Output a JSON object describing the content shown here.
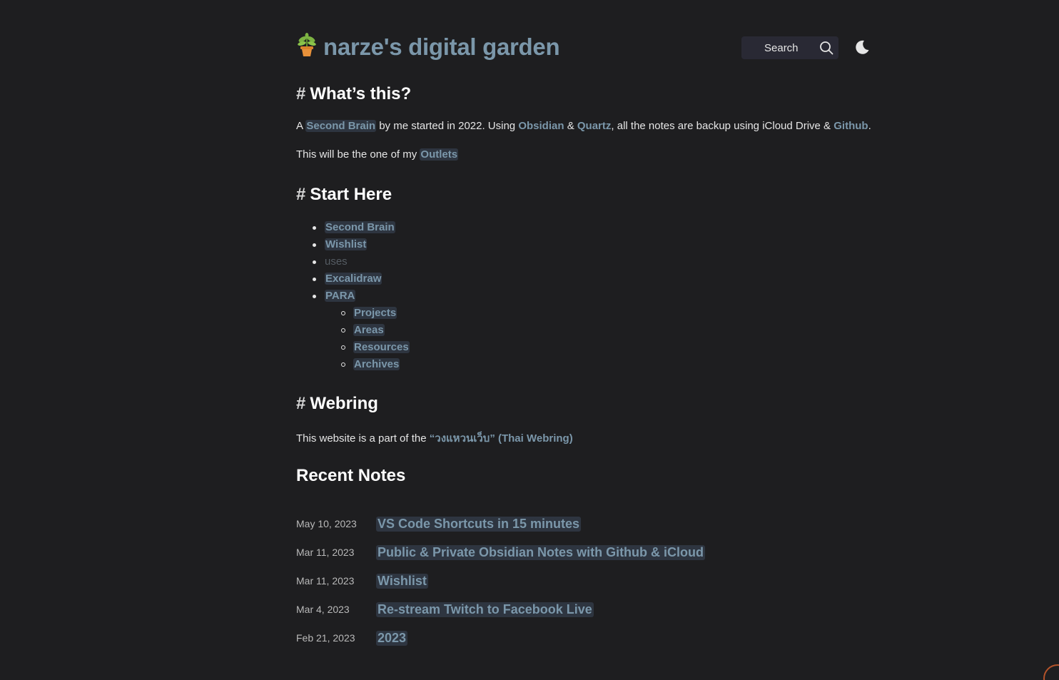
{
  "header": {
    "logo_emoji": "🪴",
    "title": "narze's digital garden",
    "search_label": "Search"
  },
  "sections": {
    "whats_this": {
      "hash": "#",
      "title": "What’s this?",
      "p1": {
        "a": "A",
        "link_second_brain": "Second Brain",
        "t1": "by me started in 2022. Using",
        "link_obsidian": "Obsidian",
        "amp1": "&",
        "link_quartz": "Quartz",
        "t2": ", all the notes are backup using iCloud Drive &",
        "link_github": "Github",
        "t3": "."
      },
      "p2": {
        "text": "This will be the one of my",
        "link_outlets": "Outlets"
      }
    },
    "start_here": {
      "hash": "#",
      "title": "Start Here",
      "items": [
        "Second Brain",
        "Wishlist",
        "uses",
        "Excalidraw",
        "PARA"
      ],
      "para_items": [
        "Projects",
        "Areas",
        "Resources",
        "Archives"
      ]
    },
    "webring": {
      "hash": "#",
      "title": "Webring",
      "text": "This website is a part of the",
      "link": "“วงแหวนเว็บ” (Thai Webring)"
    }
  },
  "recent_notes": {
    "title": "Recent Notes",
    "items": [
      {
        "date": "May 10, 2023",
        "title": "VS Code Shortcuts in 15 minutes"
      },
      {
        "date": "Mar 11, 2023",
        "title": "Public & Private Obsidian Notes with Github & iCloud"
      },
      {
        "date": "Mar 11, 2023",
        "title": "Wishlist"
      },
      {
        "date": "Mar 4, 2023",
        "title": "Re-stream Twitch to Facebook Live"
      },
      {
        "date": "Feb 21, 2023",
        "title": "2023"
      }
    ]
  },
  "colors": {
    "background": "#1e1e20",
    "link": "#7b97aa",
    "link_bg": "#2e3540",
    "text": "#e6e6e6"
  },
  "icons": {
    "search": "search-icon",
    "theme": "moon-icon"
  }
}
